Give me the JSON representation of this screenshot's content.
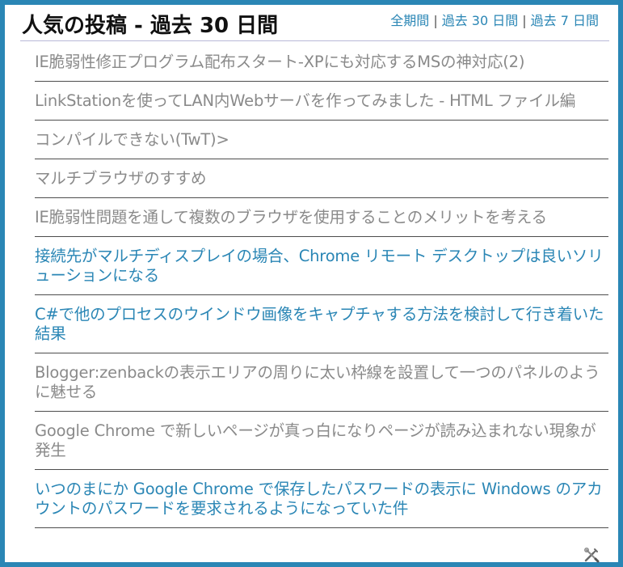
{
  "widget": {
    "title": "人気の投稿 - 過去 30 日間",
    "filters": [
      {
        "label": "全期間"
      },
      {
        "label": "過去 30 日間"
      },
      {
        "label": "過去 7 日間"
      }
    ],
    "filter_separator": "|"
  },
  "posts": [
    {
      "title": "IE脆弱性修正プログラム配布スタート-XPにも対応するMSの神対応(2)",
      "color": "#8a8a8a"
    },
    {
      "title": "LinkStationを使ってLAN内Webサーバを作ってみました - HTML ファイル編",
      "color": "#8a8a8a"
    },
    {
      "title": "コンパイルできない(TwT)>",
      "color": "#8a8a8a"
    },
    {
      "title": "マルチブラウザのすすめ",
      "color": "#8a8a8a"
    },
    {
      "title": "IE脆弱性問題を通して複数のブラウザを使用することのメリットを考える",
      "color": "#8a8a8a"
    },
    {
      "title": "接続先がマルチディスプレイの場合、Chrome リモート デスクトップは良いソリューションになる",
      "color": "#2a86b5"
    },
    {
      "title": "C#で他のプロセスのウインドウ画像をキャプチャする方法を検討して行き着いた結果",
      "color": "#2a86b5"
    },
    {
      "title": "Blogger:zenbackの表示エリアの周りに太い枠線を設置して一つのパネルのように魅せる",
      "color": "#8a8a8a"
    },
    {
      "title": "Google Chrome で新しいページが真っ白になりページが読み込まれない現象が発生",
      "color": "#8a8a8a"
    },
    {
      "title": "いつのまにか Google Chrome で保存したパスワードの表示に Windows のアカウントのパスワードを要求されるようになっていた件",
      "color": "#2a86b5"
    }
  ],
  "footer": {
    "edit_icon": "tools-icon"
  },
  "colors": {
    "frame": "#2a86b5",
    "link": "#2a86b5",
    "visited": "#8a8a8a"
  }
}
